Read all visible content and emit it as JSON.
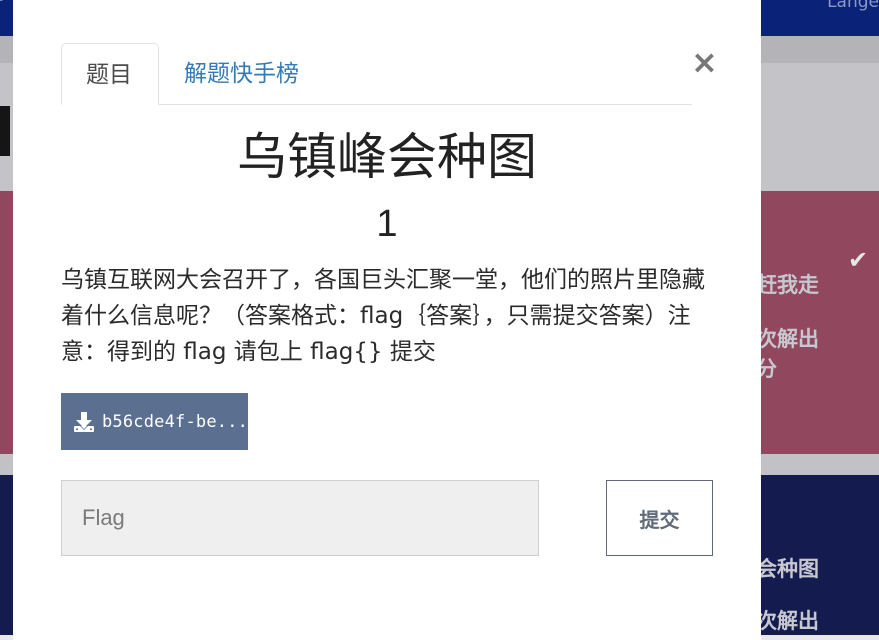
{
  "background": {
    "nav_right_text": "Lange",
    "card1_lines": [
      "赶我走",
      "次解出",
      "分"
    ],
    "card2_lines": [
      "会种图",
      "次解出"
    ]
  },
  "modal": {
    "tabs": [
      {
        "label": "题目",
        "active": true
      },
      {
        "label": "解题快手榜",
        "active": false
      }
    ],
    "close_symbol": "×",
    "challenge": {
      "title": "乌镇峰会种图",
      "points": "1",
      "description": "乌镇互联网大会召开了，各国巨头汇聚一堂，他们的照片里隐藏着什么信息呢？（答案格式：flag｛答案｝，只需提交答案）注意：得到的 flag 请包上 flag{} 提交",
      "file_label": "b56cde4f-be..."
    },
    "flag_input": {
      "placeholder": "Flag",
      "value": ""
    },
    "submit_label": "提交"
  },
  "colors": {
    "navbar": "#0a2378",
    "card_pink": "#91485e",
    "card_blue": "#141b4f",
    "download_button": "#5b7090",
    "link": "#337ab7"
  },
  "icons": {
    "close": "close-icon",
    "download": "download-icon",
    "check": "check-icon"
  }
}
